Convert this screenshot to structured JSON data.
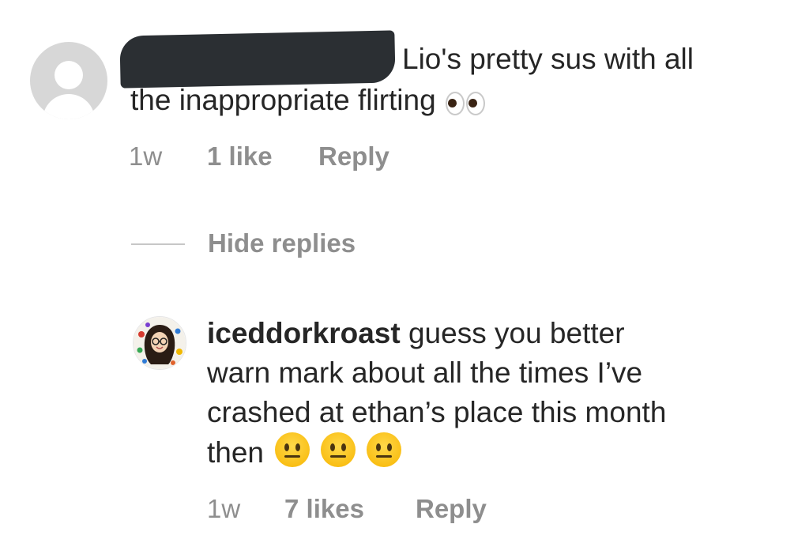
{
  "comment": {
    "line1": "Lio's pretty sus with all",
    "line2": "the inappropriate flirting",
    "emoji_icon": "eyes-icon",
    "time": "1w",
    "likes": "1 like",
    "reply_label": "Reply"
  },
  "thread": {
    "hide_replies_label": "Hide replies"
  },
  "reply": {
    "username": "iceddorkroast",
    "line1_rest": "guess you better",
    "line2": "warn mark about all the times I’ve",
    "line3": "crashed at ethan’s place this month",
    "line4": "then",
    "emoji_icon": "neutral-face-icon",
    "emoji_count": 3,
    "time": "1w",
    "likes": "7 likes",
    "reply_label": "Reply"
  },
  "colors": {
    "text_primary": "#262626",
    "text_secondary": "#8e8e8e",
    "divider": "#c7c7c7",
    "redaction": "#2b2f33",
    "avatar_placeholder": "#d7d7d7"
  }
}
